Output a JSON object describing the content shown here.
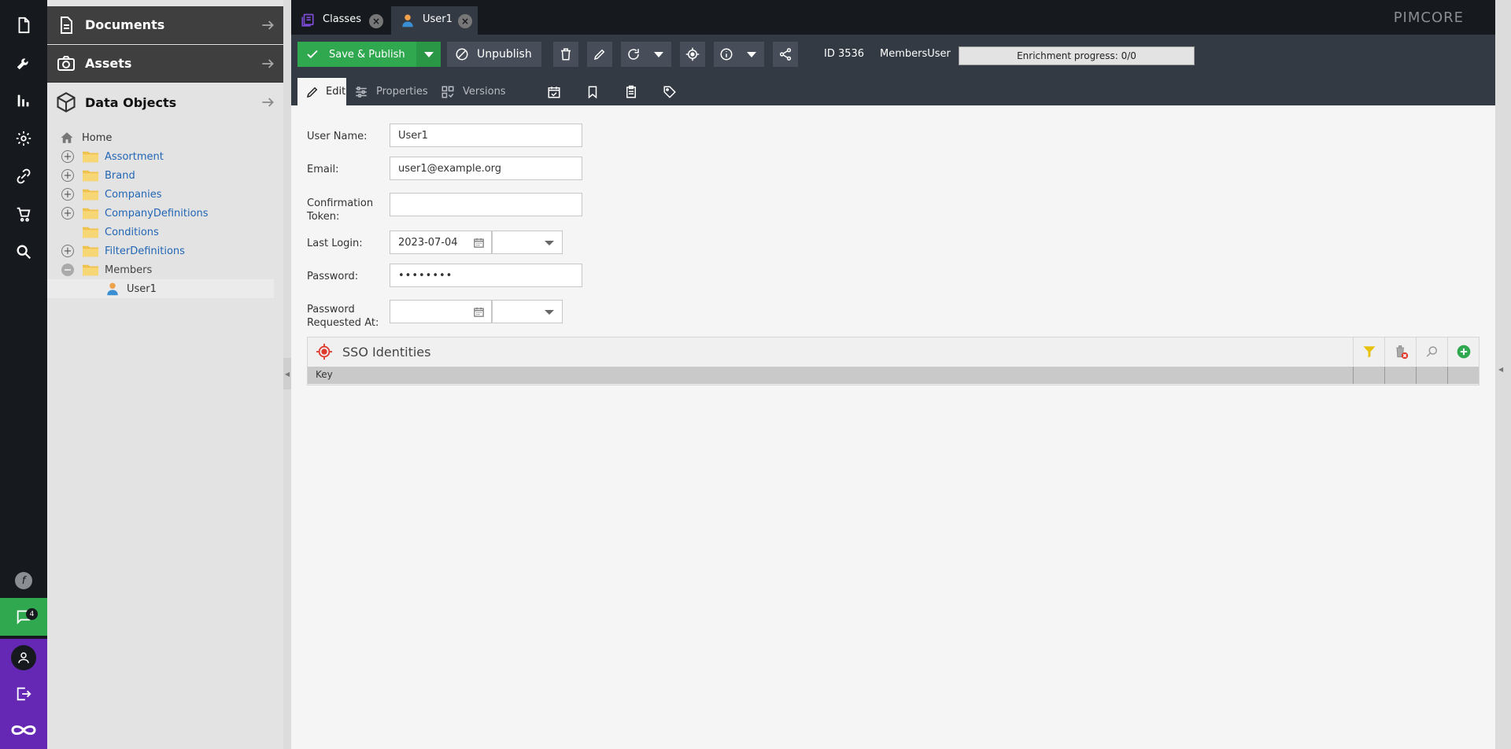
{
  "nav_tree": {
    "documents_label": "Documents",
    "assets_label": "Assets",
    "data_objects_label": "Data Objects",
    "items": [
      {
        "label": "Home"
      },
      {
        "label": "Assortment"
      },
      {
        "label": "Brand"
      },
      {
        "label": "Companies"
      },
      {
        "label": "CompanyDefinitions"
      },
      {
        "label": "Conditions"
      },
      {
        "label": "FilterDefinitions"
      },
      {
        "label": "Members"
      },
      {
        "label": "User1"
      }
    ]
  },
  "iconbar": {
    "notification_count": "4",
    "icons": [
      "file-icon",
      "tools-icon",
      "chart-icon",
      "gear-icon",
      "link-icon",
      "cart-icon",
      "search-icon",
      "symfony-icon",
      "chat-icon",
      "user-icon",
      "logout-icon",
      "pimcore-logo-icon"
    ]
  },
  "tabs": {
    "classes_label": "Classes",
    "user1_label": "User1",
    "brand": "PIMCORE"
  },
  "toolbar": {
    "save_label": "Save & Publish",
    "unpublish_label": "Unpublish",
    "id_text": "ID 3536",
    "class_text": "MembersUser",
    "progress_text": "Enrichment progress: 0/0"
  },
  "subtabs": {
    "edit_label": "Edit",
    "properties_label": "Properties",
    "versions_label": "Versions"
  },
  "form": {
    "username_label": "User Name:",
    "username_value": "User1",
    "email_label": "Email:",
    "email_value": "user1@example.org",
    "token_label_1": "Confirmation",
    "token_label_2": "Token:",
    "token_value": "",
    "lastlogin_label": "Last Login:",
    "lastlogin_date": "2023-07-04",
    "password_label": "Password:",
    "password_value": "••••••••",
    "pwreq_label_1": "Password",
    "pwreq_label_2": "Requested At:",
    "pwreq_date": ""
  },
  "sso": {
    "title": "SSO Identities",
    "col_key": "Key"
  },
  "colors": {
    "accent_green": "#2fa84f",
    "accent_purple": "#6428b4",
    "dark_bg": "#16191d",
    "toolbar_bg": "#333a44",
    "link_blue": "#2266b5"
  }
}
